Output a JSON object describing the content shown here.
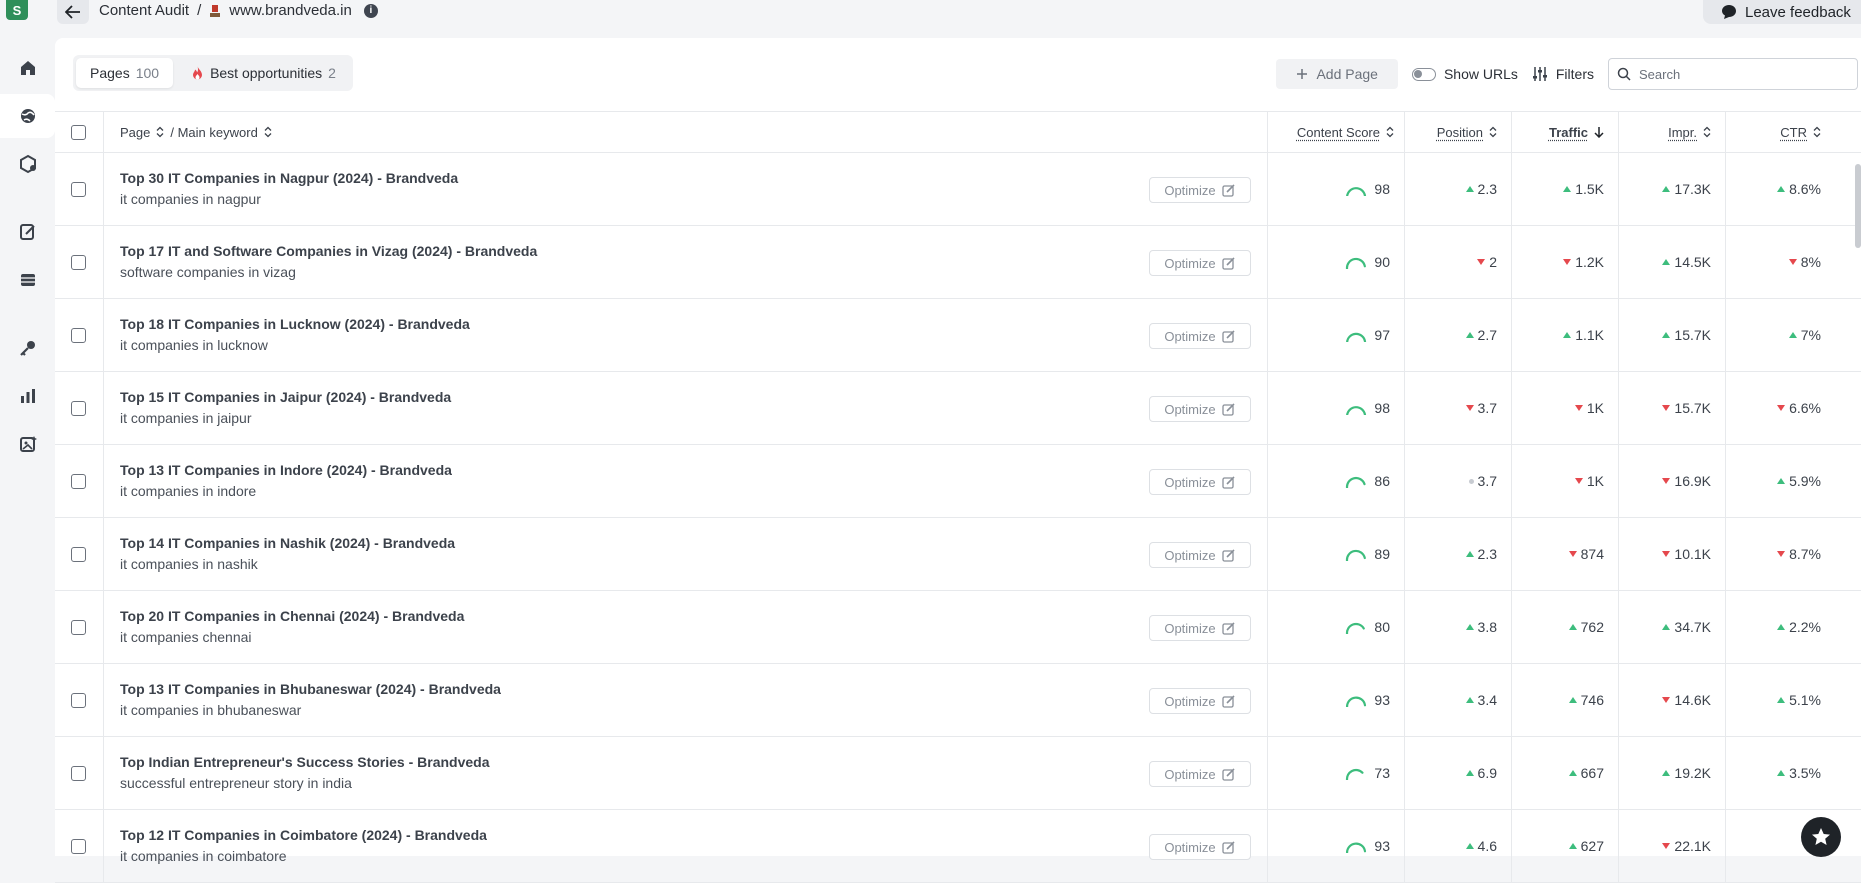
{
  "app": {
    "logo_letter": "S"
  },
  "breadcrumb": {
    "section": "Content Audit",
    "separator": "/",
    "site": "www.brandveda.in"
  },
  "feedback": {
    "label": "Leave feedback"
  },
  "tabs": [
    {
      "label": "Pages",
      "count": "100"
    },
    {
      "label": "Best opportunities",
      "count": "2"
    }
  ],
  "toolbar": {
    "add_page": "Add Page",
    "show_urls": "Show URLs",
    "filters": "Filters",
    "search_placeholder": "Search"
  },
  "table": {
    "headers": {
      "page": "Page",
      "keyword": "/ Main keyword",
      "score": "Content Score",
      "position": "Position",
      "traffic": "Traffic",
      "impr": "Impr.",
      "ctr": "CTR"
    },
    "optimize_label": "Optimize",
    "rows": [
      {
        "title": "Top 30 IT Companies in Nagpur (2024) - Brandveda",
        "keyword": "it companies in nagpur",
        "score": "98",
        "score_val": 98,
        "position": "2.3",
        "pos_trend": "up",
        "traffic": "1.5K",
        "traffic_trend": "up",
        "impr": "17.3K",
        "impr_trend": "up",
        "ctr": "8.6%",
        "ctr_trend": "up"
      },
      {
        "title": "Top 17 IT and Software Companies in Vizag (2024) - Brandveda",
        "keyword": "software companies in vizag",
        "score": "90",
        "score_val": 90,
        "position": "2",
        "pos_trend": "down",
        "traffic": "1.2K",
        "traffic_trend": "down",
        "impr": "14.5K",
        "impr_trend": "up",
        "ctr": "8%",
        "ctr_trend": "down"
      },
      {
        "title": "Top 18 IT Companies in Lucknow (2024) - Brandveda",
        "keyword": "it companies in lucknow",
        "score": "97",
        "score_val": 97,
        "position": "2.7",
        "pos_trend": "up",
        "traffic": "1.1K",
        "traffic_trend": "up",
        "impr": "15.7K",
        "impr_trend": "up",
        "ctr": "7%",
        "ctr_trend": "up"
      },
      {
        "title": "Top 15 IT Companies in Jaipur (2024) - Brandveda",
        "keyword": "it companies in jaipur",
        "score": "98",
        "score_val": 98,
        "position": "3.7",
        "pos_trend": "down",
        "traffic": "1K",
        "traffic_trend": "down",
        "impr": "15.7K",
        "impr_trend": "down",
        "ctr": "6.6%",
        "ctr_trend": "down"
      },
      {
        "title": "Top 13 IT Companies in Indore (2024) - Brandveda",
        "keyword": "it companies in indore",
        "score": "86",
        "score_val": 86,
        "position": "3.7",
        "pos_trend": "flat",
        "traffic": "1K",
        "traffic_trend": "down",
        "impr": "16.9K",
        "impr_trend": "down",
        "ctr": "5.9%",
        "ctr_trend": "up"
      },
      {
        "title": "Top 14 IT Companies in Nashik (2024) - Brandveda",
        "keyword": "it companies in nashik",
        "score": "89",
        "score_val": 89,
        "position": "2.3",
        "pos_trend": "up",
        "traffic": "874",
        "traffic_trend": "down",
        "impr": "10.1K",
        "impr_trend": "down",
        "ctr": "8.7%",
        "ctr_trend": "down"
      },
      {
        "title": "Top 20 IT Companies in Chennai (2024) - Brandveda",
        "keyword": "it companies chennai",
        "score": "80",
        "score_val": 80,
        "position": "3.8",
        "pos_trend": "up",
        "traffic": "762",
        "traffic_trend": "up",
        "impr": "34.7K",
        "impr_trend": "up",
        "ctr": "2.2%",
        "ctr_trend": "up"
      },
      {
        "title": "Top 13 IT Companies in Bhubaneswar (2024) - Brandveda",
        "keyword": "it companies in bhubaneswar",
        "score": "93",
        "score_val": 93,
        "position": "3.4",
        "pos_trend": "up",
        "traffic": "746",
        "traffic_trend": "up",
        "impr": "14.6K",
        "impr_trend": "down",
        "ctr": "5.1%",
        "ctr_trend": "up"
      },
      {
        "title": "Top Indian Entrepreneur's Success Stories - Brandveda",
        "keyword": "successful entrepreneur story in india",
        "score": "73",
        "score_val": 73,
        "position": "6.9",
        "pos_trend": "up",
        "traffic": "667",
        "traffic_trend": "up",
        "impr": "19.2K",
        "impr_trend": "up",
        "ctr": "3.5%",
        "ctr_trend": "up"
      },
      {
        "title": "Top 12 IT Companies in Coimbatore (2024) - Brandveda",
        "keyword": "it companies in coimbatore",
        "score": "93",
        "score_val": 93,
        "position": "4.6",
        "pos_trend": "up",
        "traffic": "627",
        "traffic_trend": "up",
        "impr": "22.1K",
        "impr_trend": "down",
        "ctr": "",
        "ctr_trend": "up"
      }
    ]
  },
  "colors": {
    "up": "#3dbd7d",
    "down": "#e5484d",
    "flat": "#c7cbd1",
    "score_arc": "#3dbd7d",
    "brand": "#2f8f5a"
  },
  "icons": [
    "home-icon",
    "globe-icon",
    "hexagon-icon",
    "edit-doc-icon",
    "table-icon",
    "key-icon",
    "bar-chart-icon",
    "ai-image-icon",
    "star-icon",
    "fire-icon",
    "plus-icon",
    "sliders-icon",
    "search-icon",
    "chat-icon",
    "arrow-left-icon",
    "info-icon",
    "sort-icon",
    "arrow-down-icon",
    "edit-icon"
  ]
}
